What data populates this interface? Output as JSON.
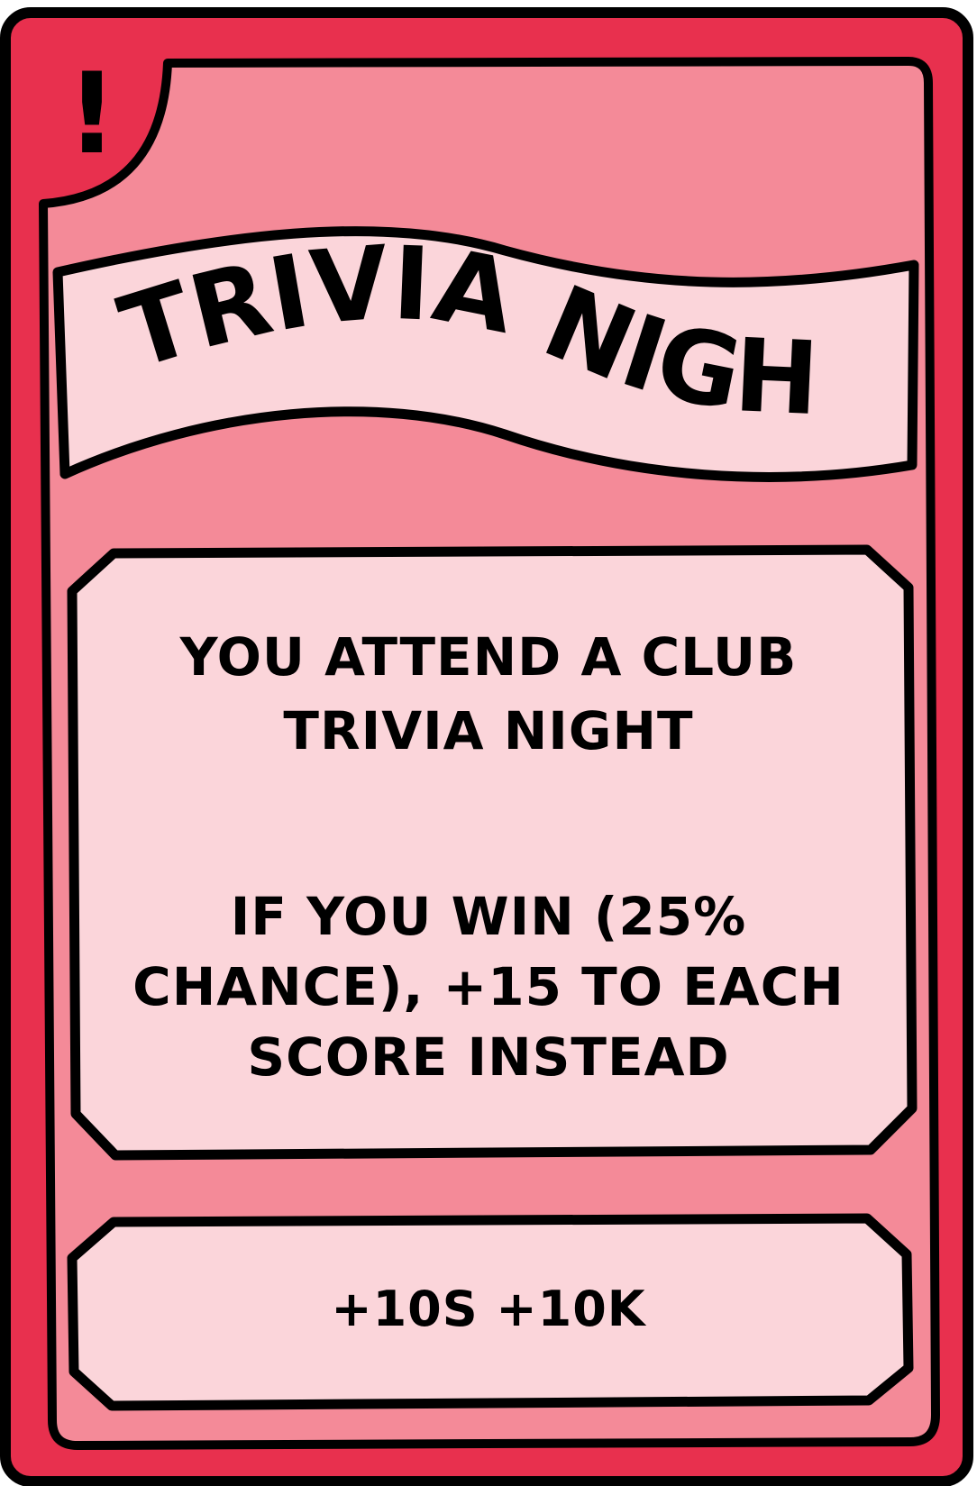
{
  "card": {
    "title": "TRIVIA NIGHT",
    "description": "YOU ATTEND A CLUB TRIVIA NIGHT",
    "effect": "IF YOU WIN (25% CHANCE), +15 TO EACH SCORE INSTEAD",
    "reward": "+10S +10K",
    "corner_icon": "exclamation-icon",
    "corner_mark": "!"
  },
  "colors": {
    "outer_frame": "#e8304e",
    "inner_panel": "#f48a98",
    "text_panel": "#fbd5da",
    "outline": "#000000"
  }
}
